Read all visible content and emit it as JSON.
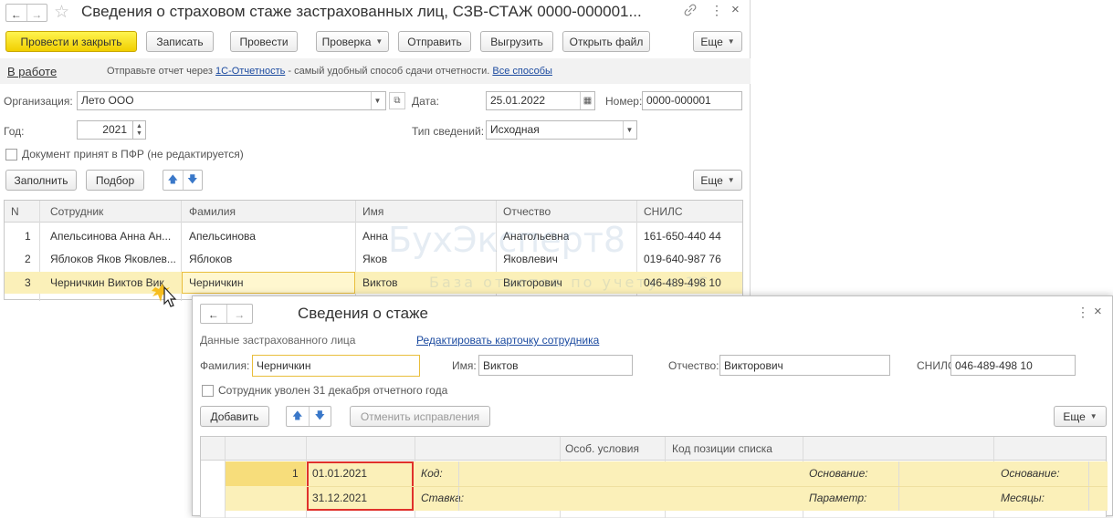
{
  "window": {
    "title": "Сведения о страховом стаже застрахованных лиц, СЗВ-СТАЖ 0000-000001...",
    "nav_back": "←",
    "nav_forward": "→",
    "star": "☆",
    "link_icon": "🔗",
    "more_icon": "⋮",
    "close_icon": "×"
  },
  "toolbar": {
    "post_close": "Провести и закрыть",
    "save": "Записать",
    "post": "Провести",
    "check": "Проверка",
    "send": "Отправить",
    "export": "Выгрузить",
    "open_file": "Открыть файл",
    "more": "Еще"
  },
  "info_bar": {
    "status": "В работе",
    "text_before": "Отправьте отчет через ",
    "link1": "1С-Отчетность",
    "text_after": " - самый удобный способ сдачи отчетности. ",
    "link2": "Все способы"
  },
  "form": {
    "org_label": "Организация:",
    "org_value": "Лето ООО",
    "date_label": "Дата:",
    "date_value": "25.01.2022",
    "number_label": "Номер:",
    "number_value": "0000-000001",
    "year_label": "Год:",
    "year_value": "2021",
    "info_type_label": "Тип сведений:",
    "info_type_value": "Исходная",
    "accepted_label": "Документ принят в ПФР (не редактируется)"
  },
  "table_toolbar": {
    "fill": "Заполнить",
    "pick": "Подбор",
    "up": "🡅",
    "down": "🡇",
    "more": "Еще"
  },
  "employees_table": {
    "columns": [
      "N",
      "Сотрудник",
      "Фамилия",
      "Имя",
      "Отчество",
      "СНИЛС"
    ],
    "rows": [
      {
        "n": "1",
        "employee": "Апельсинова Анна Ан...",
        "last": "Апельсинова",
        "first": "Анна",
        "middle": "Анатольевна",
        "snils": "161-650-440 44"
      },
      {
        "n": "2",
        "employee": "Яблоков Яков Яковлев...",
        "last": "Яблоков",
        "first": "Яков",
        "middle": "Яковлевич",
        "snils": "019-640-987 76"
      },
      {
        "n": "3",
        "employee": "Черничкин Виктов Вик",
        "last": "Черничкин",
        "first": "Виктов",
        "middle": "Викторович",
        "snils": "046-489-498 10"
      }
    ]
  },
  "watermark": {
    "brand": "БухЭксперт8",
    "sub": "База ответов по учету в 1С"
  },
  "dialog": {
    "title": "Сведения о стаже",
    "section": "Данные застрахованного лица",
    "edit_link": "Редактировать карточку сотрудника",
    "last_label": "Фамилия:",
    "last_value": "Черничкин",
    "first_label": "Имя:",
    "first_value": "Виктов",
    "middle_label": "Отчество:",
    "middle_value": "Викторович",
    "snils_label": "СНИЛС:",
    "snils_value": "046-489-498 10",
    "dismissed_label": "Сотрудник уволен 31 декабря отчетного года",
    "add": "Добавить",
    "cancel_fix": "Отменить исправления",
    "more": "Еще",
    "columns": {
      "special": "Особ. условия",
      "position_code": "Код позиции списка"
    },
    "row": {
      "n": "1",
      "start": "01.01.2021",
      "end": "31.12.2021",
      "code_label": "Код:",
      "rate_label": "Ставка:",
      "basis_label1": "Основание:",
      "param_label": "Параметр:",
      "basis_label2": "Основание:",
      "months_label": "Месяцы:"
    }
  },
  "colors": {
    "primary_button": "#f5dc1c",
    "selection_row": "#fbf0b9",
    "link": "#1c4ba0",
    "highlight_box": "#e0312b",
    "focus_border": "#e9be3c"
  }
}
